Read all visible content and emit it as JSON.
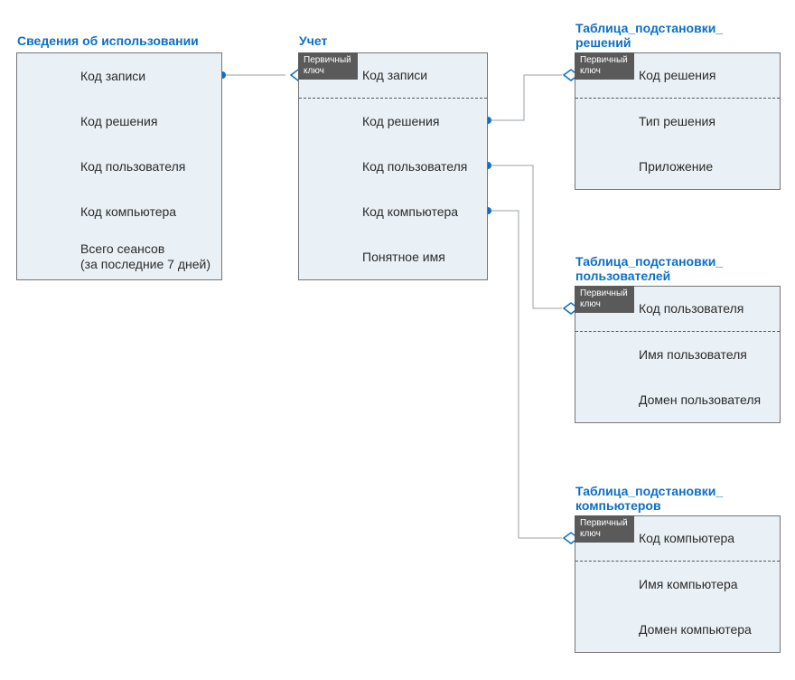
{
  "colors": {
    "title": "#0c6fc7",
    "box_bg": "#eaf1f6",
    "box_border": "#757575",
    "pk_tag_bg": "#5a5a5a"
  },
  "pk_label": "Первичный\nключ",
  "tables": {
    "usage": {
      "title": "Сведения об использовании",
      "rows": [
        "Код записи",
        "Код решения",
        "Код пользователя",
        "Код компьютера",
        "Всего сеансов\n(за последние 7 дней)"
      ]
    },
    "uchet": {
      "title": "Учет",
      "pk": "Код записи",
      "rows": [
        "Код решения",
        "Код пользователя",
        "Код компьютера",
        "Понятное имя"
      ]
    },
    "resh": {
      "title": "Таблица_подстановки_\nрешений",
      "pk": "Код решения",
      "rows": [
        "Тип решения",
        "Приложение"
      ]
    },
    "users": {
      "title": "Таблица_подстановки_\nпользователей",
      "pk": "Код пользователя",
      "rows": [
        "Имя пользователя",
        "Домен пользователя"
      ]
    },
    "comp": {
      "title": "Таблица_подстановки_\nкомпьютеров",
      "pk": "Код компьютера",
      "rows": [
        "Имя компьютера",
        "Домен компьютера"
      ]
    }
  },
  "relationships": [
    {
      "from": "usage.row0",
      "to": "uchet.pk"
    },
    {
      "from": "uchet.row0",
      "to": "resh.pk"
    },
    {
      "from": "uchet.row1",
      "to": "users.pk"
    },
    {
      "from": "uchet.row2",
      "to": "comp.pk"
    }
  ]
}
